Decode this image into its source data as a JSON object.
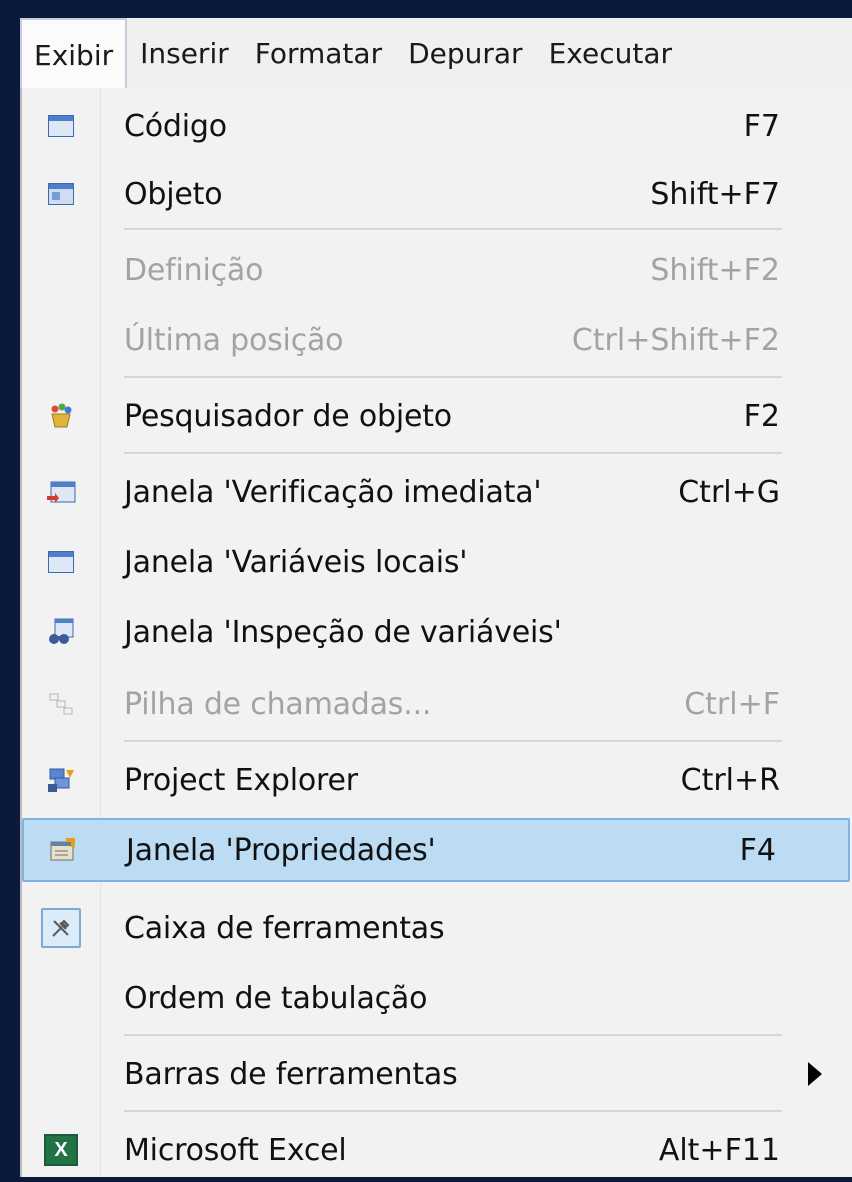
{
  "menubar": {
    "items": [
      {
        "label": "Exibir",
        "active": true
      },
      {
        "label": "Inserir"
      },
      {
        "label": "Formatar"
      },
      {
        "label": "Depurar"
      },
      {
        "label": "Executar"
      }
    ]
  },
  "menu": {
    "items": [
      {
        "label": "Código",
        "shortcut": "F7",
        "icon": "code-window-icon"
      },
      {
        "label": "Objeto",
        "shortcut": "Shift+F7",
        "icon": "object-icon"
      },
      {
        "label": "Definição",
        "shortcut": "Shift+F2",
        "disabled": true
      },
      {
        "label": "Última posição",
        "shortcut": "Ctrl+Shift+F2",
        "disabled": true
      },
      {
        "label": "Pesquisador de objeto",
        "shortcut": "F2",
        "icon": "object-browser-icon"
      },
      {
        "label": "Janela 'Verificação imediata'",
        "shortcut": "Ctrl+G",
        "icon": "immediate-window-icon"
      },
      {
        "label": "Janela 'Variáveis locais'",
        "shortcut": "",
        "icon": "locals-window-icon"
      },
      {
        "label": "Janela 'Inspeção de variáveis'",
        "shortcut": "",
        "icon": "watch-window-icon"
      },
      {
        "label": "Pilha de chamadas...",
        "shortcut": "Ctrl+F",
        "disabled": true,
        "icon": "call-stack-icon"
      },
      {
        "label": "Project Explorer",
        "shortcut": "Ctrl+R",
        "icon": "project-explorer-icon"
      },
      {
        "label": "Janela 'Propriedades'",
        "shortcut": "F4",
        "highlighted": true,
        "icon": "properties-window-icon"
      },
      {
        "label": "Caixa de ferramentas",
        "shortcut": "",
        "icon": "toolbox-icon"
      },
      {
        "label": "Ordem de tabulação",
        "shortcut": ""
      },
      {
        "label": "Barras de ferramentas",
        "shortcut": "",
        "submenu": true
      },
      {
        "label": "Microsoft Excel",
        "shortcut": "Alt+F11",
        "icon": "excel-icon"
      }
    ]
  }
}
